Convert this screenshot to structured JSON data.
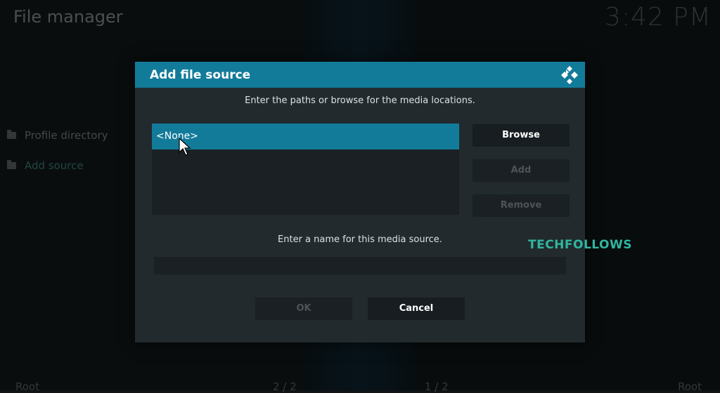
{
  "app": {
    "title": "File manager",
    "clock": "3:42 PM"
  },
  "sidebar": {
    "items": [
      {
        "label": "Profile directory"
      },
      {
        "label": "Add source"
      }
    ]
  },
  "footer": {
    "left_label": "Root",
    "center_left": "2 / 2",
    "center_right": "1 / 2",
    "right_label": "Root"
  },
  "dialog": {
    "title": "Add file source",
    "paths_instruction": "Enter the paths or browse for the media locations.",
    "paths": [
      {
        "label": "<None>",
        "selected": true
      }
    ],
    "browse_label": "Browse",
    "add_label": "Add",
    "remove_label": "Remove",
    "name_instruction": "Enter a name for this media source.",
    "name_value": "",
    "ok_label": "OK",
    "cancel_label": "Cancel"
  },
  "watermark": "TECHFOLLOWS",
  "colors": {
    "accent": "#137b9a",
    "dialog_bg": "#222a2d",
    "watermark": "#2fb6a0"
  }
}
